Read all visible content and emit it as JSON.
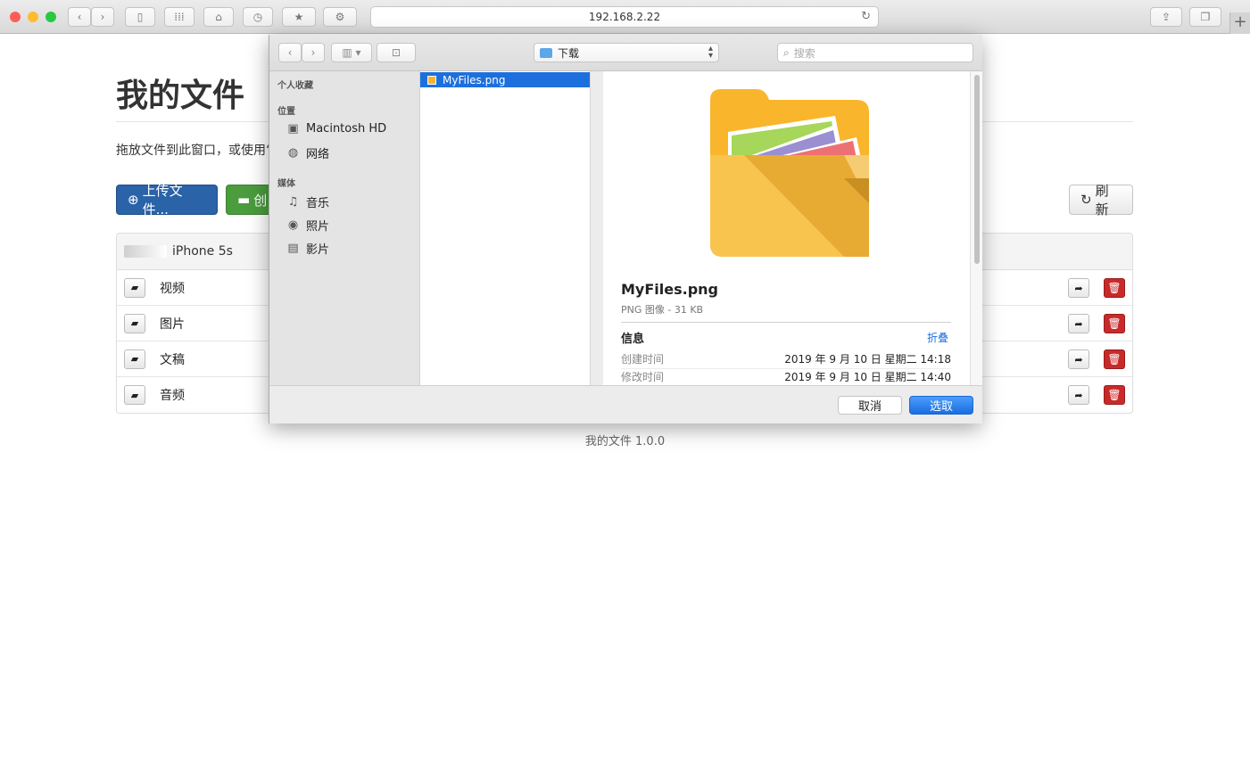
{
  "browser": {
    "url": "192.168.2.22",
    "new_tab_label": "+",
    "colors": {
      "close": "#fd5e56",
      "minimize": "#fdbc2e",
      "maximize": "#28c93f"
    }
  },
  "page": {
    "title": "我的文件",
    "description": "拖放文件到此窗口，或使用“",
    "upload_label": "上传文件...",
    "create_label": "创",
    "refresh_label": "刷新",
    "device_name": "iPhone 5s",
    "folders": [
      {
        "name": "视频"
      },
      {
        "name": "图片"
      },
      {
        "name": "文稿"
      },
      {
        "name": "音频"
      }
    ],
    "footer": "我的文件 1.0.0",
    "colors": {
      "primary": "#2a63a8",
      "success": "#4a9c3d",
      "danger": "#c82a2a"
    }
  },
  "dialog": {
    "location": "下载",
    "search_placeholder": "搜索",
    "sidebar": {
      "favorites_header": "个人收藏",
      "locations_header": "位置",
      "locations": [
        "Macintosh HD",
        "网络"
      ],
      "media_header": "媒体",
      "media": [
        "音乐",
        "照片",
        "影片"
      ]
    },
    "selected_file": "MyFiles.png",
    "preview": {
      "name": "MyFiles.png",
      "meta": "PNG 图像 - 31 KB",
      "info_label": "信息",
      "collapse_label": "折叠",
      "rows": [
        {
          "label": "创建时间",
          "value": "2019 年 9 月 10 日 星期二 14:18"
        },
        {
          "label": "修改时间",
          "value": "2019 年 9 月 10 日 星期二 14:40"
        }
      ]
    },
    "cancel_label": "取消",
    "choose_label": "选取",
    "accent": "#1d6fde"
  }
}
